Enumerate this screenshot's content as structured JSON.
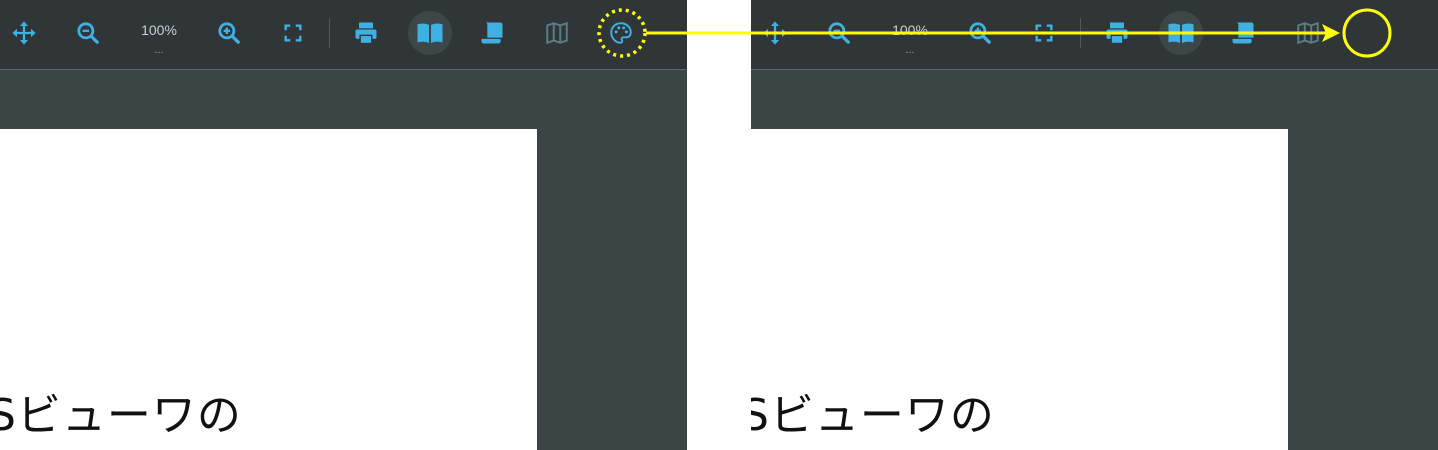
{
  "toolbar": {
    "zoom_level": "100%",
    "zoom_more": "...",
    "tools": [
      "pan-icon",
      "zoom-out-icon",
      "zoom-in-icon",
      "fullscreen-icon",
      "print-icon",
      "book-icon",
      "scroll-icon",
      "map-icon",
      "palette-icon"
    ]
  },
  "document": {
    "visible_text": "Sビューワの"
  },
  "colors": {
    "toolbar_bg": "#303637",
    "viewer_bg": "#3b4546",
    "icon_blue": "#3fb0e4",
    "icon_dim": "#5b7c87",
    "annotation": "#ffff00"
  }
}
